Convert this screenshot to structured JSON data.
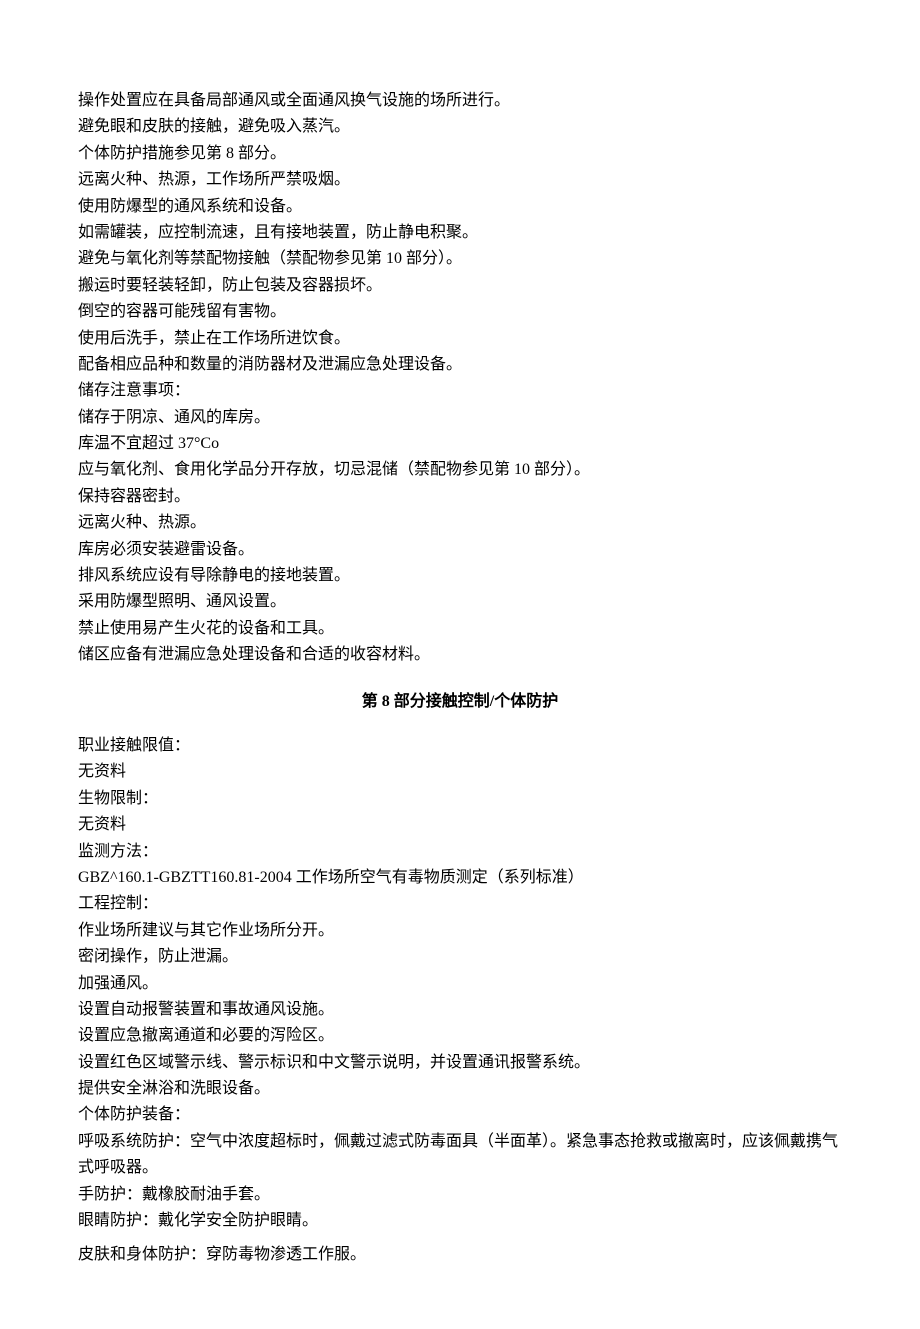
{
  "section7": {
    "lines": [
      "操作处置应在具备局部通风或全面通风换气设施的场所进行。",
      "避免眼和皮肤的接触，避免吸入蒸汽。",
      "个体防护措施参见第 8 部分。",
      "远离火种、热源，工作场所严禁吸烟。",
      "使用防爆型的通风系统和设备。",
      "如需罐装，应控制流速，且有接地装置，防止静电积聚。",
      "避免与氧化剂等禁配物接触（禁配物参见第 10 部分）。",
      "搬运时要轻装轻卸，防止包装及容器损坏。",
      "倒空的容器可能残留有害物。",
      "使用后洗手，禁止在工作场所进饮食。",
      "配备相应品种和数量的消防器材及泄漏应急处理设备。",
      "储存注意事项：",
      "储存于阴凉、通风的库房。",
      "库温不宜超过 37°Co",
      "应与氧化剂、食用化学品分开存放，切忌混储（禁配物参见第 10 部分）。",
      "保持容器密封。",
      "远离火种、热源。",
      "库房必须安装避雷设备。",
      "排风系统应设有导除静电的接地装置。",
      "采用防爆型照明、通风设置。",
      "禁止使用易产生火花的设备和工具。",
      "储区应备有泄漏应急处理设备和合适的收容材料。"
    ]
  },
  "section8": {
    "heading": "第 8 部分接触控制/个体防护",
    "lines": [
      "职业接触限值：",
      "无资料",
      "生物限制：",
      "无资料",
      "监测方法：",
      "GBZ^160.1-GBZTT160.81-2004 工作场所空气有毒物质测定（系列标准）",
      "工程控制：",
      "作业场所建议与其它作业场所分开。",
      "密闭操作，防止泄漏。",
      "加强通风。",
      "设置自动报警装置和事故通风设施。",
      "设置应急撤离通道和必要的泻险区。",
      "设置红色区域警示线、警示标识和中文警示说明，并设置通讯报警系统。",
      "提供安全淋浴和洗眼设备。",
      "个体防护装备：",
      "呼吸系统防护：空气中浓度超标时，佩戴过滤式防毒面具（半面革）。紧急事态抢救或撤离时，应该佩戴携气式呼吸器。",
      "手防护：戴橡胶耐油手套。",
      "眼睛防护：戴化学安全防护眼睛。"
    ],
    "last_line": "皮肤和身体防护：穿防毒物渗透工作服。"
  }
}
